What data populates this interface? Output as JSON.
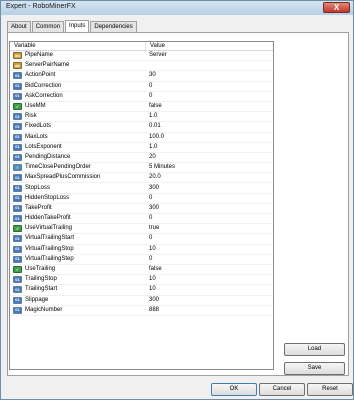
{
  "window": {
    "title": "Expert - RoboMinerFX",
    "close_label": "X"
  },
  "tabs": [
    "About",
    "Common",
    "Inputs",
    "Dependencies"
  ],
  "active_tab": "Inputs",
  "grid": {
    "headers": {
      "variable": "Variable",
      "value": "Value"
    },
    "rows": [
      {
        "name": "PipeName",
        "value": "Server",
        "icon": "ab-icon"
      },
      {
        "name": "ServerPairName",
        "value": "",
        "icon": "ab-icon"
      },
      {
        "name": "ActionPoint",
        "value": "30",
        "icon": "number-icon"
      },
      {
        "name": "BidCorrection",
        "value": "0",
        "icon": "number-icon"
      },
      {
        "name": "AskCorrection",
        "value": "0",
        "icon": "number-icon"
      },
      {
        "name": "UseMM",
        "value": "false",
        "icon": "bool-icon"
      },
      {
        "name": "Risk",
        "value": "1.0",
        "icon": "number-icon"
      },
      {
        "name": "FixedLots",
        "value": "0.01",
        "icon": "number-icon"
      },
      {
        "name": "MaxLots",
        "value": "100.0",
        "icon": "number-icon"
      },
      {
        "name": "LotsExponent",
        "value": "1.0",
        "icon": "number-icon"
      },
      {
        "name": "PendingDistance",
        "value": "20",
        "icon": "number-icon"
      },
      {
        "name": "TimeClosePendingOrder",
        "value": "5 Minutes",
        "icon": "list-icon"
      },
      {
        "name": "MaxSpreadPlusCommission",
        "value": "20.0",
        "icon": "number-icon"
      },
      {
        "name": "StopLoss",
        "value": "300",
        "icon": "number-icon"
      },
      {
        "name": "HiddenStopLoss",
        "value": "0",
        "icon": "number-icon"
      },
      {
        "name": "TakeProfit",
        "value": "300",
        "icon": "number-icon"
      },
      {
        "name": "HiddenTakeProfit",
        "value": "0",
        "icon": "number-icon"
      },
      {
        "name": "UseVirtualTrailing",
        "value": "true",
        "icon": "bool-icon"
      },
      {
        "name": "VirtualTrailingStart",
        "value": "0",
        "icon": "number-icon"
      },
      {
        "name": "VirtualTrailingStop",
        "value": "10",
        "icon": "number-icon"
      },
      {
        "name": "VirtualTrailingStep",
        "value": "0",
        "icon": "number-icon"
      },
      {
        "name": "UseTrailing",
        "value": "false",
        "icon": "bool-icon"
      },
      {
        "name": "TrailingStop",
        "value": "10",
        "icon": "number-icon"
      },
      {
        "name": "TrailingStart",
        "value": "10",
        "icon": "number-icon"
      },
      {
        "name": "Slippage",
        "value": "300",
        "icon": "number-icon"
      },
      {
        "name": "MagicNumber",
        "value": "888",
        "icon": "number-icon"
      }
    ]
  },
  "buttons": {
    "load": "Load",
    "save": "Save",
    "ok": "OK",
    "cancel": "Cancel",
    "reset": "Reset"
  }
}
